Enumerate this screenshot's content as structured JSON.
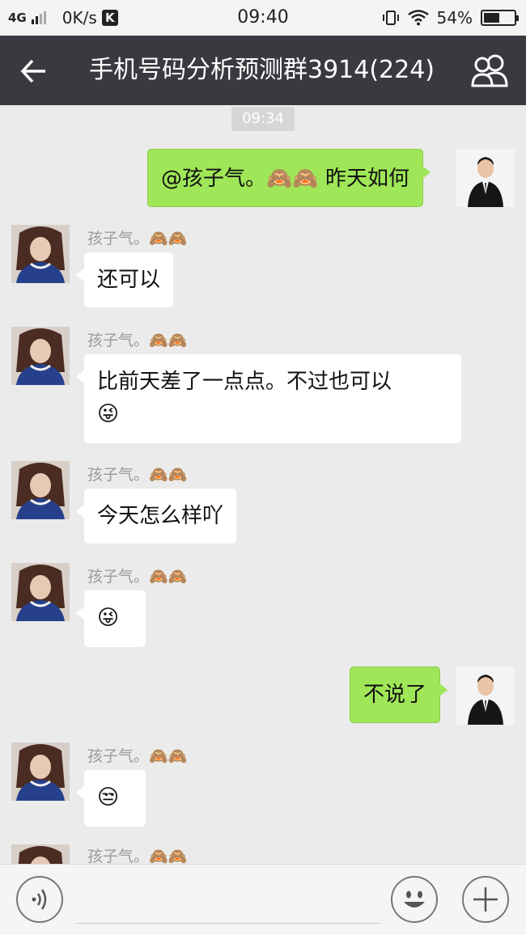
{
  "status_bar": {
    "network": "4G",
    "speed": "0K/s",
    "k_badge": "K",
    "time": "09:40",
    "battery": "54%",
    "battery_level": 0.54
  },
  "header": {
    "title": "手机号码分析预测群3914(224)",
    "back_icon": "back-arrow-icon",
    "group_icon": "group-members-icon"
  },
  "timestamp": "09:34",
  "messages": [
    {
      "side": "out",
      "text": "@孩子气。🙈🙈 昨天如何"
    },
    {
      "side": "in",
      "sender": "孩子气。🙈🙈",
      "text": "还可以"
    },
    {
      "side": "in",
      "sender": "孩子气。🙈🙈",
      "text": "比前天差了一点点。不过也可以",
      "emoji": "😜"
    },
    {
      "side": "in",
      "sender": "孩子气。🙈🙈",
      "text": "今天怎么样吖"
    },
    {
      "side": "in",
      "sender": "孩子气。🙈🙈",
      "emoji": "😜"
    },
    {
      "side": "out",
      "text": "不说了"
    },
    {
      "side": "in",
      "sender": "孩子气。🙈🙈",
      "emoji": "😒"
    },
    {
      "side": "in",
      "sender": "孩子气。🙈🙈"
    }
  ],
  "input_bar": {
    "voice_icon": "voice-icon",
    "emoji_icon": "smiley-icon",
    "plus_icon": "plus-icon"
  },
  "colors": {
    "title_bar": "#393a3f",
    "outgoing_bubble": "#9fe658",
    "chat_background": "#ebebeb"
  }
}
